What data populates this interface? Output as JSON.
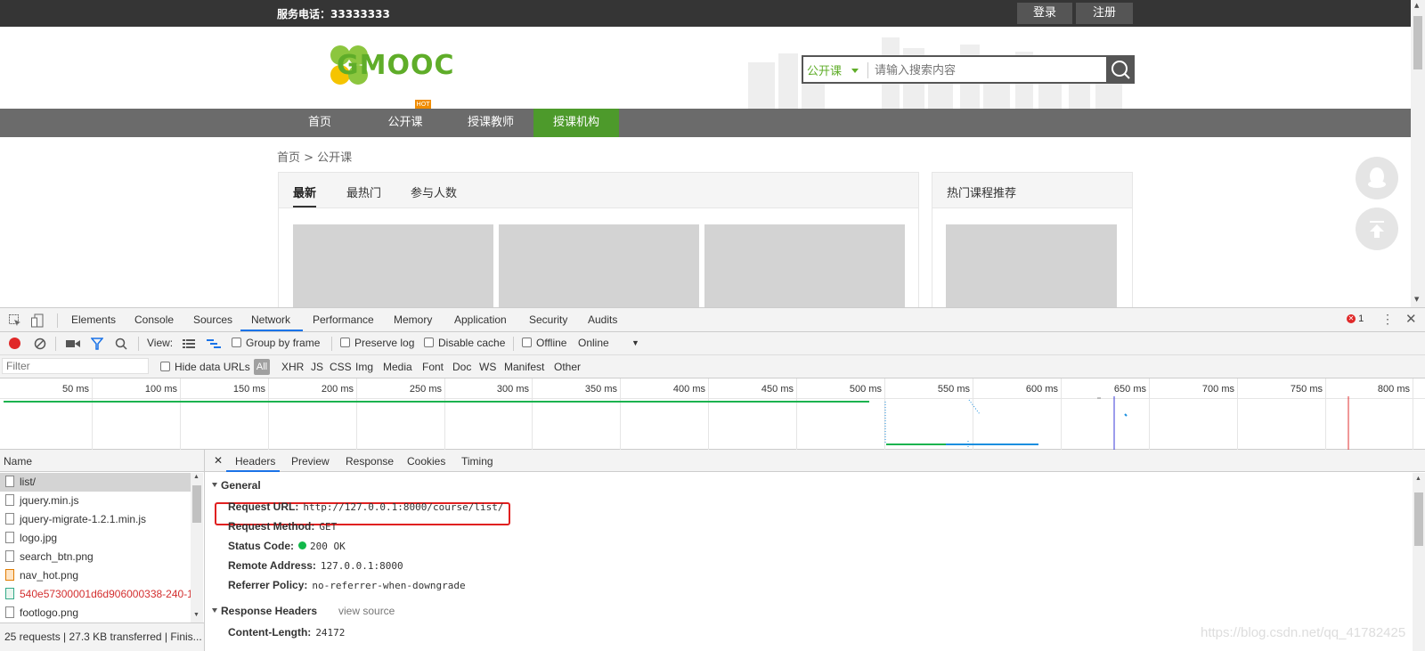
{
  "site": {
    "phone_label": "服务电话：33333333",
    "login_label": "登录",
    "register_label": "注册",
    "logo_text": "GMOOC",
    "search": {
      "category": "公开课",
      "placeholder": "请输入搜索内容"
    },
    "nav": [
      "首页",
      "公开课",
      "授课教师",
      "授课机构"
    ],
    "nav_active_index": 3,
    "hot_badge": "HOT",
    "breadcrumb": "首页 > 公开课",
    "tabs": [
      "最新",
      "最热门",
      "参与人数"
    ],
    "side_title": "热门课程推荐",
    "colors": {
      "brand_green": "#5fad29",
      "nav_active": "#4d9a2b",
      "topbar": "#353535",
      "navbar": "#6b6b6b"
    }
  },
  "devtools": {
    "tabs": [
      "Elements",
      "Console",
      "Sources",
      "Network",
      "Performance",
      "Memory",
      "Application",
      "Security",
      "Audits"
    ],
    "active_tab": "Network",
    "error_count": "1",
    "toolbar": {
      "view_label": "View:",
      "group_by_frame": "Group by frame",
      "preserve_log": "Preserve log",
      "disable_cache": "Disable cache",
      "offline": "Offline",
      "throttle": "Online"
    },
    "filter": {
      "placeholder": "Filter",
      "hide_data_urls": "Hide data URLs",
      "types": [
        "All",
        "XHR",
        "JS",
        "CSS",
        "Img",
        "Media",
        "Font",
        "Doc",
        "WS",
        "Manifest",
        "Other"
      ]
    },
    "timeline_ticks": [
      "50 ms",
      "100 ms",
      "150 ms",
      "200 ms",
      "250 ms",
      "300 ms",
      "350 ms",
      "400 ms",
      "450 ms",
      "500 ms",
      "550 ms",
      "600 ms",
      "650 ms",
      "700 ms",
      "750 ms",
      "800 ms"
    ],
    "name_header": "Name",
    "requests": [
      {
        "name": "list/",
        "type": "doc",
        "selected": true
      },
      {
        "name": "jquery.min.js",
        "type": "doc"
      },
      {
        "name": "jquery-migrate-1.2.1.min.js",
        "type": "doc"
      },
      {
        "name": "logo.jpg",
        "type": "doc"
      },
      {
        "name": "search_btn.png",
        "type": "doc"
      },
      {
        "name": "nav_hot.png",
        "type": "img"
      },
      {
        "name": "540e57300001d6d906000338-240-1",
        "type": "brokenimg",
        "error": true
      },
      {
        "name": "footlogo.png",
        "type": "doc"
      }
    ],
    "status_bar": "25 requests | 27.3 KB transferred | Finis...",
    "detail_tabs": [
      "Headers",
      "Preview",
      "Response",
      "Cookies",
      "Timing"
    ],
    "active_detail_tab": "Headers",
    "general_title": "General",
    "general": [
      {
        "key": "Request URL:",
        "value": "http://127.0.0.1:8000/course/list/"
      },
      {
        "key": "Request Method:",
        "value": "GET"
      },
      {
        "key": "Status Code:",
        "value": "200 OK"
      },
      {
        "key": "Remote Address:",
        "value": "127.0.0.1:8000"
      },
      {
        "key": "Referrer Policy:",
        "value": "no-referrer-when-downgrade"
      }
    ],
    "response_headers_title": "Response Headers",
    "view_source": "view source",
    "response_headers": [
      {
        "key": "Content-Length:",
        "value": "24172"
      }
    ],
    "colors": {
      "accent": "#1a73e8",
      "error": "#e02828",
      "status_ok": "#12b84a"
    }
  },
  "watermark": "https://blog.csdn.net/qq_41782425"
}
